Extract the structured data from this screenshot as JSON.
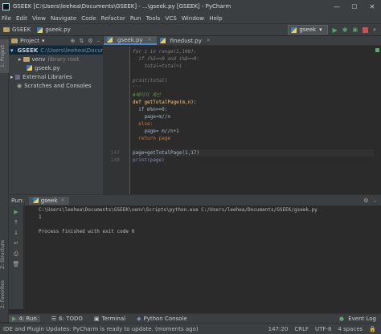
{
  "titlebar": {
    "title": "GSEEK [C:\\Users\\leehea\\Documents\\GSEEK] - ...\\gseek.py [GSEEK] - PyCharm",
    "minimize": "—",
    "maximize": "☐",
    "close": "✕"
  },
  "menu": [
    "File",
    "Edit",
    "View",
    "Navigate",
    "Code",
    "Refactor",
    "Run",
    "Tools",
    "VCS",
    "Window",
    "Help"
  ],
  "navbar": {
    "project": "GSEEK",
    "file": "gseek.py",
    "run_config": "gseek"
  },
  "project_panel": {
    "title": "Project",
    "tree": [
      {
        "label": "GSEEK",
        "extra": "C:\\Users\\leehea\\Documents\\GSEEK"
      },
      {
        "label": "venv",
        "extra": "library root"
      },
      {
        "label": "gseek.py",
        "extra": ""
      },
      {
        "label": "External Libraries",
        "extra": ""
      },
      {
        "label": "Scratches and Consoles",
        "extra": ""
      }
    ]
  },
  "left_tools": {
    "project": "1: Project",
    "structure": "Z: Structure",
    "favorites": "2: Favorites"
  },
  "tabs": [
    {
      "label": "gseek.py"
    },
    {
      "label": "finedust.py"
    }
  ],
  "editor": {
    "line_numbers": [
      "147",
      "148"
    ],
    "lines": [
      {
        "t": "for i in range(1,100):"
      },
      {
        "t": "  if i%5==0 and i%8==0:"
      },
      {
        "t": "    total=total+i"
      },
      {
        "t": ""
      },
      {
        "t": "print(total)"
      },
      {
        "t": "'''"
      },
      {
        "t": "#페이지 계산"
      },
      {
        "t": "def getTotalPage(m,n):"
      },
      {
        "t": "  if m%n==0:"
      },
      {
        "t": "    page=m//n"
      },
      {
        "t": "  else:"
      },
      {
        "t": "    page= m//n+1"
      },
      {
        "t": "  return page"
      },
      {
        "t": ""
      },
      {
        "t": "page=getTotalPage(1,17)"
      },
      {
        "t": "print(page)"
      }
    ]
  },
  "run_panel": {
    "label": "Run:",
    "tab": "gseek",
    "console": [
      "C:\\Users\\leehea\\Documents\\GSEEK\\venv\\Scripts\\python.exe C:/Users/leehea/Documents/GSEEK/gseek.py",
      "1",
      "",
      "Process finished with exit code 0"
    ]
  },
  "bottom_tabs": [
    {
      "label": "4: Run",
      "icon": "▶"
    },
    {
      "label": "6: TODO",
      "icon": "☰"
    },
    {
      "label": "Terminal",
      "icon": "▣"
    },
    {
      "label": "Python Console",
      "icon": "◆"
    }
  ],
  "event_log": "Event Log",
  "status": {
    "message": "IDE and Plugin Updates: PyCharm is ready to update. (moments ago)",
    "position": "147:20",
    "line_sep": "CRLF",
    "encoding": "UTF-8",
    "indent": "4 spaces"
  }
}
